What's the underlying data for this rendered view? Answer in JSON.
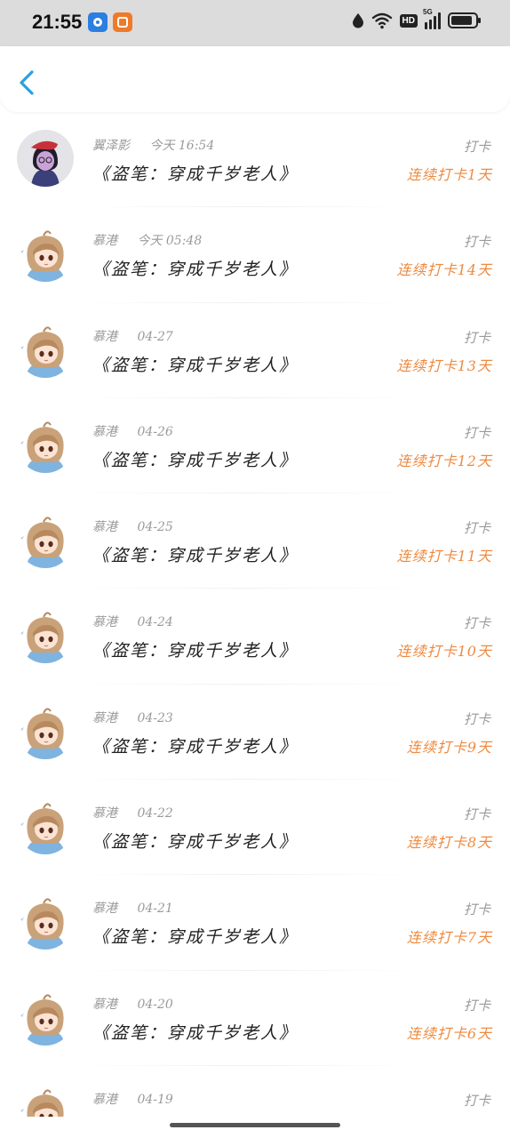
{
  "status_bar": {
    "time": "21:55",
    "hd_label": "HD",
    "signal_label": "5G",
    "battery_level": 0.9
  },
  "header": {
    "back_icon": "chevron-left-icon",
    "accent_color": "#2aa0e0"
  },
  "colors": {
    "streak": "#ee8a40",
    "meta": "#9a9a9a",
    "title": "#222222"
  },
  "checkins": [
    {
      "user": "翼泽影",
      "time": "今天 16:54",
      "book": "《盗笔：穿成千岁老人》",
      "action": "打卡",
      "streak": "连续打卡1天",
      "avatar": "avatar-red-beret"
    },
    {
      "user": "慕港",
      "time": "今天 05:48",
      "book": "《盗笔：穿成千岁老人》",
      "action": "打卡",
      "streak": "连续打卡14天",
      "avatar": "avatar-anime-girl"
    },
    {
      "user": "慕港",
      "time": "04-27",
      "book": "《盗笔：穿成千岁老人》",
      "action": "打卡",
      "streak": "连续打卡13天",
      "avatar": "avatar-anime-girl"
    },
    {
      "user": "慕港",
      "time": "04-26",
      "book": "《盗笔：穿成千岁老人》",
      "action": "打卡",
      "streak": "连续打卡12天",
      "avatar": "avatar-anime-girl"
    },
    {
      "user": "慕港",
      "time": "04-25",
      "book": "《盗笔：穿成千岁老人》",
      "action": "打卡",
      "streak": "连续打卡11天",
      "avatar": "avatar-anime-girl"
    },
    {
      "user": "慕港",
      "time": "04-24",
      "book": "《盗笔：穿成千岁老人》",
      "action": "打卡",
      "streak": "连续打卡10天",
      "avatar": "avatar-anime-girl"
    },
    {
      "user": "慕港",
      "time": "04-23",
      "book": "《盗笔：穿成千岁老人》",
      "action": "打卡",
      "streak": "连续打卡9天",
      "avatar": "avatar-anime-girl"
    },
    {
      "user": "慕港",
      "time": "04-22",
      "book": "《盗笔：穿成千岁老人》",
      "action": "打卡",
      "streak": "连续打卡8天",
      "avatar": "avatar-anime-girl"
    },
    {
      "user": "慕港",
      "time": "04-21",
      "book": "《盗笔：穿成千岁老人》",
      "action": "打卡",
      "streak": "连续打卡7天",
      "avatar": "avatar-anime-girl"
    },
    {
      "user": "慕港",
      "time": "04-20",
      "book": "《盗笔：穿成千岁老人》",
      "action": "打卡",
      "streak": "连续打卡6天",
      "avatar": "avatar-anime-girl"
    },
    {
      "user": "慕港",
      "time": "04-19",
      "book": "",
      "action": "打卡",
      "streak": "",
      "avatar": "avatar-anime-girl"
    }
  ]
}
